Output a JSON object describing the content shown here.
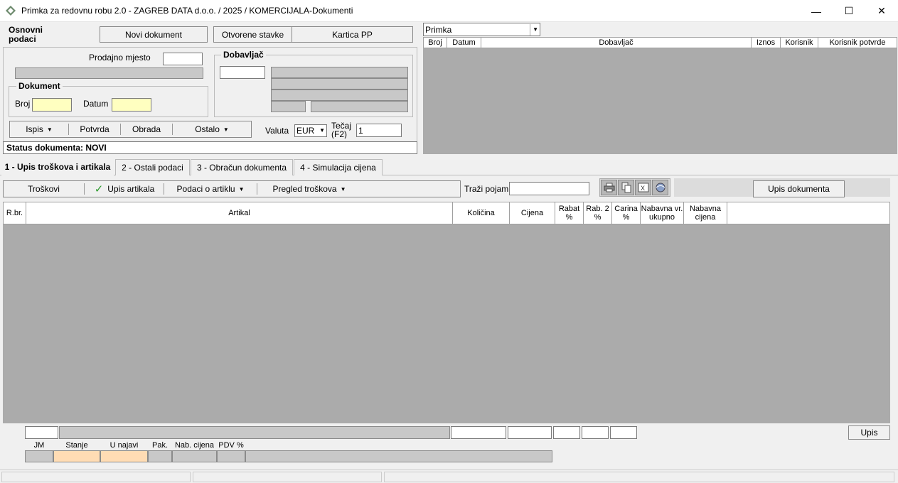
{
  "window": {
    "title": "Primka za redovnu robu  2.0 - ZAGREB DATA d.o.o.   /    2025    /  KOMERCIJALA-Dokumenti",
    "minimize": "—",
    "maximize": "☐",
    "close": "✕"
  },
  "top": {
    "section_label": "Osnovni podaci",
    "novi_dokument": "Novi dokument",
    "otvorene_stavke": "Otvorene stavke",
    "kartica_pp": "Kartica PP",
    "prodajno_mjesto_label": "Prodajno mjesto",
    "prodajno_mjesto_value": "",
    "dokument_group": "Dokument",
    "broj_label": "Broj",
    "datum_label": "Datum",
    "dobavljac_group": "Dobavljač",
    "ispis": "Ispis",
    "potvrda": "Potvrda",
    "obrada": "Obrada",
    "ostalo": "Ostalo",
    "valuta_label": "Valuta",
    "valuta_value": "EUR",
    "tecaj_label": "Tečaj (F2)",
    "tecaj_value": "1",
    "status": "Status dokumenta: NOVI"
  },
  "right_list": {
    "type_select": "Primka",
    "columns": [
      "Broj",
      "Datum",
      "Dobavljač",
      "Iznos",
      "Korisnik",
      "Korisnik potvrde"
    ]
  },
  "tabs": [
    {
      "label": "1 - Upis troškova i artikala",
      "active": true
    },
    {
      "label": "2 - Ostali podaci",
      "active": false
    },
    {
      "label": "3 - Obračun dokumenta",
      "active": false
    },
    {
      "label": "4 - Simulacija cijena",
      "active": false
    }
  ],
  "toolbar": {
    "troskovi": "Troškovi",
    "upis_artikala": "Upis artikala",
    "podaci_o_artiklu": "Podaci o artiklu",
    "pregled_troskova": "Pregled troškova",
    "trazi_pojam_label": "Traži pojam",
    "upis_dokumenta": "Upis dokumenta"
  },
  "grid": {
    "columns": [
      "R.br.",
      "Artikal",
      "Količina",
      "Cijena",
      "Rabat %",
      "Rab. 2 %",
      "Carina %",
      "Nabavna vr. ukupno",
      "Nabavna cijena"
    ]
  },
  "bottom": {
    "upis": "Upis",
    "info_labels": [
      "JM",
      "Stanje",
      "U najavi",
      "Pak.",
      "Nab. cijena",
      "PDV %"
    ]
  },
  "colors": {
    "grid_bg": "#ababab",
    "highlight_input": "#ffffc0",
    "stanje_cell": "#ffdcb4"
  }
}
